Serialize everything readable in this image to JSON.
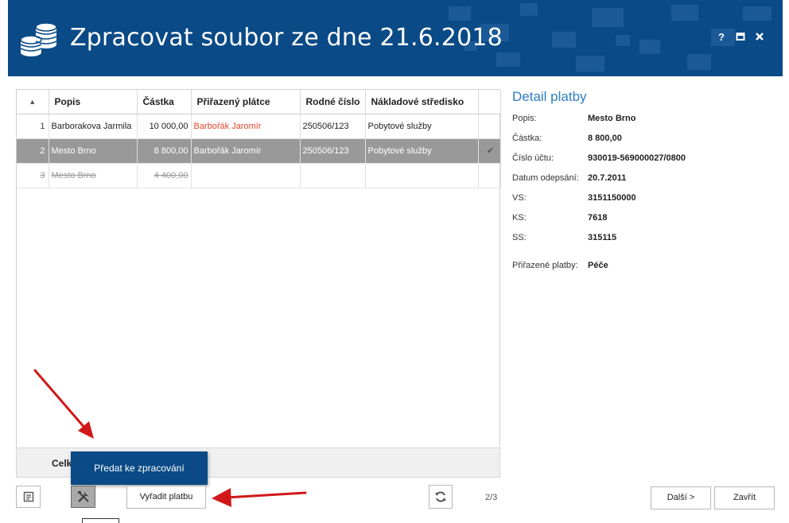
{
  "window": {
    "title": "Zpracovat soubor ze dne 21.6.2018",
    "help_label": "?",
    "colors": {
      "header": "#0a4a86",
      "accent": "#2d7dc6",
      "assigned_red": "#e3452e",
      "selected_row": "#999999"
    }
  },
  "grid": {
    "sort_indicator": "▲",
    "columns": [
      "Popis",
      "Částka",
      "Přiřazený plátce",
      "Rodné číslo",
      "Nákladové středisko"
    ],
    "rows": [
      {
        "num": "1",
        "popis": "Barborakova Jarmila",
        "castka": "10 000,00",
        "platce": "Barbořák Jaromír",
        "rc": "250506/123",
        "stredisko": "Pobytové služby",
        "check": ""
      },
      {
        "num": "2",
        "popis": "Mesto Brno",
        "castka": "8 800,00",
        "platce": "Barbořák Jaromír",
        "rc": "250506/123",
        "stredisko": "Pobytové služby",
        "check": "✔"
      },
      {
        "num": "3",
        "popis": "Mesto Brno",
        "castka": "4 400,00",
        "platce": "",
        "rc": "",
        "stredisko": "",
        "check": ""
      }
    ],
    "footer_label": "Celk"
  },
  "popup": {
    "label": "Předat ke zpracování"
  },
  "toolbar": {
    "remove_label": "Vyřadit platbu",
    "pager": "2/3",
    "next_label": "Další >",
    "close_label": "Zavřít"
  },
  "detail": {
    "title": "Detail platby",
    "fields": [
      {
        "label": "Popis:",
        "value": "Mesto Brno"
      },
      {
        "label": "Částka:",
        "value": "8 800,00"
      },
      {
        "label": "Číslo účtu:",
        "value": "930019-569000027/0800"
      },
      {
        "label": "Datum odepsání:",
        "value": "20.7.2011"
      },
      {
        "label": "VS:",
        "value": "3151150000"
      },
      {
        "label": "KS:",
        "value": "7618"
      },
      {
        "label": "SS:",
        "value": "315115"
      }
    ],
    "assigned": {
      "label": "Přiřazené platby:",
      "value": "Péče"
    }
  }
}
